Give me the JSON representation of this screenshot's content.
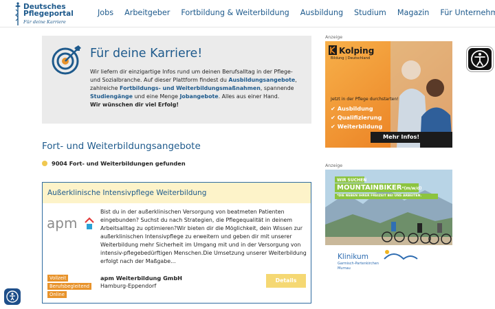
{
  "header": {
    "logo_line1": "Deutsches",
    "logo_line2": "Pflegeportal",
    "logo_tagline": "Für deine Karriere",
    "nav": [
      "Jobs",
      "Arbeitgeber",
      "Fortbildung & Weiterbildung",
      "Ausbildung",
      "Studium",
      "Magazin",
      "Für Unternehmen"
    ]
  },
  "intro": {
    "title": "Für deine Karriere!",
    "text_1": "Wir liefern dir einzigartige Infos rund um deinen Berufsalltag in der Pflege- und Sozialbranche. Auf dieser Plattform findest du ",
    "link_1": "Ausbildungsangebote",
    "text_2": ", zahlreiche ",
    "link_2": "Fortbildungs- und Weiterbildungsmaßnahmen",
    "text_3": ", spannende ",
    "link_3": "Studiengänge",
    "text_4": " und eine Menge ",
    "link_4": "Jobangebote",
    "text_5": ". Alles aus einer Hand.",
    "closing": "Wir wünschen dir viel Erfolg!"
  },
  "section": {
    "title": "Fort- und Weiterbildungsangebote",
    "result_count": "9004 Fort- und Weiterbildungen gefunden"
  },
  "card": {
    "title": "Außerklinische Intensivpflege Weiterbildung",
    "logo_text": "apm",
    "description": "Bist du in der außerklinischen Versorgung von beatmeten Patienten eingebunden? Suchst du nach Strategien, die Pflegequalität in deinem Arbeitsalltag zu optimieren?Wir bieten dir die Möglichkeit, dein Wissen zur außerklinischen Intensivpflege zu erweitern und geben dir mit unserer Weiterbildung mehr Sicherheit im Umgang mit und in der Versorgung von intensiv-pflegebedürftigen Menschen.Die Umsetzung unserer Weiterbildung erfolgt nach der Maßgabe...",
    "badges": [
      "Vollzeit",
      "Berufsbegleitend",
      "Online"
    ],
    "company": "apm Weiterbildung GmbH",
    "location": "Hamburg-Eppendorf",
    "details_label": "Details"
  },
  "ads": {
    "label": "Anzeige",
    "ad1": {
      "brand": "Kolping",
      "brand_sub": "Bildung | Deutschland",
      "headline": "Jetzt in der Pflege durchstarten!",
      "items": [
        "Ausbildung",
        "Qualifizierung",
        "Weiterbildung"
      ],
      "cta": "Mehr Infos!"
    },
    "ad2": {
      "line1": "WIR SUCHEN",
      "line2": "MOUNTAINBIKER",
      "line2_suffix": "*(m/w/d)",
      "line3": "*DIE NEBEN IHRER FREIZEIT BEI UNS ARBEITEN.",
      "clinic_name": "Klinikum",
      "clinic_sub1": "Garmisch-Partenkirchen",
      "clinic_sub2": "Murnau"
    }
  },
  "colors": {
    "brand_blue": "#1e5a8c",
    "badge_orange": "#e8932b",
    "card_header": "#fdf3c9",
    "details_button": "#f5d873"
  }
}
